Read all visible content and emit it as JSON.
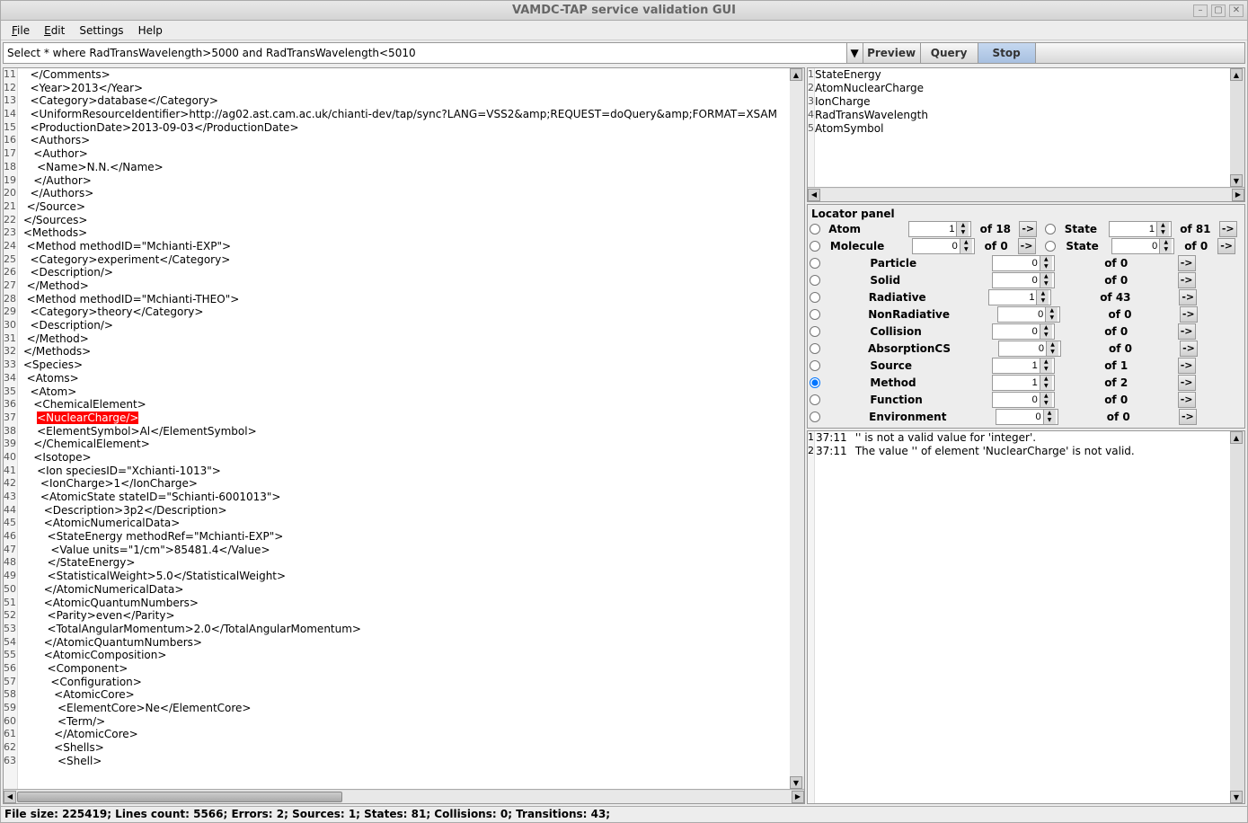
{
  "window": {
    "title": "VAMDC-TAP service validation GUI"
  },
  "menubar": [
    {
      "label": "File",
      "u": "F"
    },
    {
      "label": "Edit",
      "u": "E"
    },
    {
      "label": "Settings",
      "u": ""
    },
    {
      "label": "Help",
      "u": ""
    }
  ],
  "query": {
    "value": "Select * where RadTransWavelength>5000 and RadTransWavelength<5010",
    "buttons": {
      "preview": "Preview",
      "query": "Query",
      "stop": "Stop"
    }
  },
  "code": {
    "first_line": 11,
    "lines": [
      "   </Comments>",
      "   <Year>2013</Year>",
      "   <Category>database</Category>",
      "   <UniformResourceIdentifier>http://ag02.ast.cam.ac.uk/chianti-dev/tap/sync?LANG=VSS2&amp;REQUEST=doQuery&amp;FORMAT=XSAM",
      "   <ProductionDate>2013-09-03</ProductionDate>",
      "   <Authors>",
      "    <Author>",
      "     <Name>N.N.</Name>",
      "    </Author>",
      "   </Authors>",
      "  </Source>",
      " </Sources>",
      " <Methods>",
      "  <Method methodID=\"Mchianti-EXP\">",
      "   <Category>experiment</Category>",
      "   <Description/>",
      "  </Method>",
      "  <Method methodID=\"Mchianti-THEO\">",
      "   <Category>theory</Category>",
      "   <Description/>",
      "  </Method>",
      " </Methods>",
      " <Species>",
      "  <Atoms>",
      "   <Atom>",
      "    <ChemicalElement>",
      "     <NuclearCharge/>",
      "     <ElementSymbol>Al</ElementSymbol>",
      "    </ChemicalElement>",
      "    <Isotope>",
      "     <Ion speciesID=\"Xchianti-1013\">",
      "      <IonCharge>1</IonCharge>",
      "      <AtomicState stateID=\"Schianti-6001013\">",
      "       <Description>3p2</Description>",
      "       <AtomicNumericalData>",
      "        <StateEnergy methodRef=\"Mchianti-EXP\">",
      "         <Value units=\"1/cm\">85481.4</Value>",
      "        </StateEnergy>",
      "        <StatisticalWeight>5.0</StatisticalWeight>",
      "       </AtomicNumericalData>",
      "       <AtomicQuantumNumbers>",
      "        <Parity>even</Parity>",
      "        <TotalAngularMomentum>2.0</TotalAngularMomentum>",
      "       </AtomicQuantumNumbers>",
      "       <AtomicComposition>",
      "        <Component>",
      "         <Configuration>",
      "          <AtomicCore>",
      "           <ElementCore>Ne</ElementCore>",
      "           <Term/>",
      "          </AtomicCore>",
      "          <Shells>",
      "           <Shell>"
    ],
    "error_line_index": 26
  },
  "restrictables": {
    "items": [
      "StateEnergy",
      "AtomNuclearCharge",
      "IonCharge",
      "RadTransWavelength",
      "AtomSymbol"
    ]
  },
  "locator": {
    "title": "Locator panel",
    "rows": [
      {
        "label": "Atom",
        "value": 1,
        "total": 18,
        "side": {
          "label": "State",
          "value": 1,
          "total": 81
        }
      },
      {
        "label": "Molecule",
        "value": 0,
        "total": 0,
        "side": {
          "label": "State",
          "value": 0,
          "total": 0
        }
      },
      {
        "label": "Particle",
        "value": 0,
        "total": 0
      },
      {
        "label": "Solid",
        "value": 0,
        "total": 0
      },
      {
        "label": "Radiative",
        "value": 1,
        "total": 43
      },
      {
        "label": "NonRadiative",
        "value": 0,
        "total": 0
      },
      {
        "label": "Collision",
        "value": 0,
        "total": 0
      },
      {
        "label": "AbsorptionCS",
        "value": 0,
        "total": 0
      },
      {
        "label": "Source",
        "value": 1,
        "total": 1
      },
      {
        "label": "Method",
        "value": 1,
        "total": 2,
        "selected": true
      },
      {
        "label": "Function",
        "value": 0,
        "total": 0
      },
      {
        "label": "Environment",
        "value": 0,
        "total": 0
      }
    ]
  },
  "errors": [
    {
      "n": 1,
      "pos": "37:11",
      "msg": "'' is not a valid value for 'integer'."
    },
    {
      "n": 2,
      "pos": "37:11",
      "msg": "The value '' of element 'NuclearCharge' is not valid."
    }
  ],
  "statusbar": "File size: 225419; Lines count: 5566; Errors: 2; Sources: 1; States: 81; Collisions: 0; Transitions: 43;"
}
